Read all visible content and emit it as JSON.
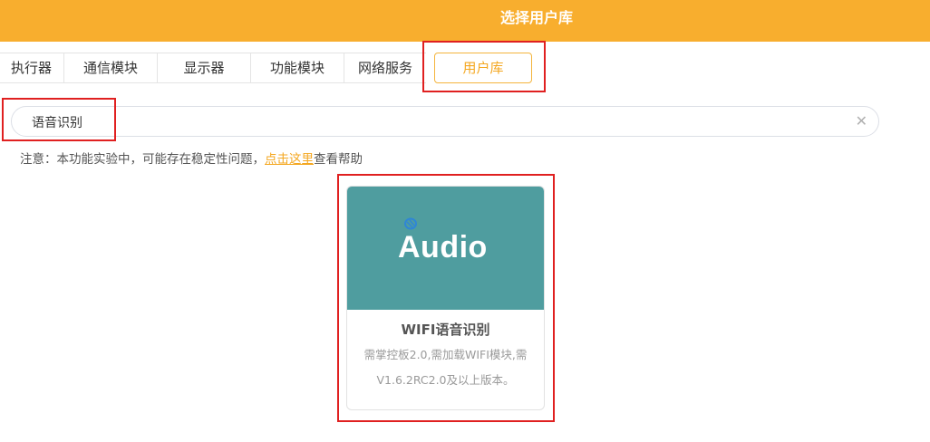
{
  "header": {
    "title": "选择用户库"
  },
  "tabs": [
    {
      "label": "执行器"
    },
    {
      "label": "通信模块"
    },
    {
      "label": "显示器"
    },
    {
      "label": "功能模块"
    },
    {
      "label": "网络服务"
    },
    {
      "label": "用户库",
      "active": true
    }
  ],
  "search": {
    "value": "语音识别",
    "clear_icon": "close-icon"
  },
  "notice": {
    "prefix": "注意：本功能实验中，可能存在稳定性问题，",
    "link": "点击这里",
    "suffix": "查看帮助"
  },
  "library_card": {
    "logo_text": "Audio",
    "name": "WIFI语音识别",
    "description_line1": "需掌控板2.0,需加载WIFI模块,需",
    "description_line2": "V1.6.2RC2.0及以上版本。"
  },
  "colors": {
    "header": "#f8ae2e",
    "accent": "#f4a720",
    "thumb": "#4f9d9f",
    "highlight": "#e02020"
  }
}
